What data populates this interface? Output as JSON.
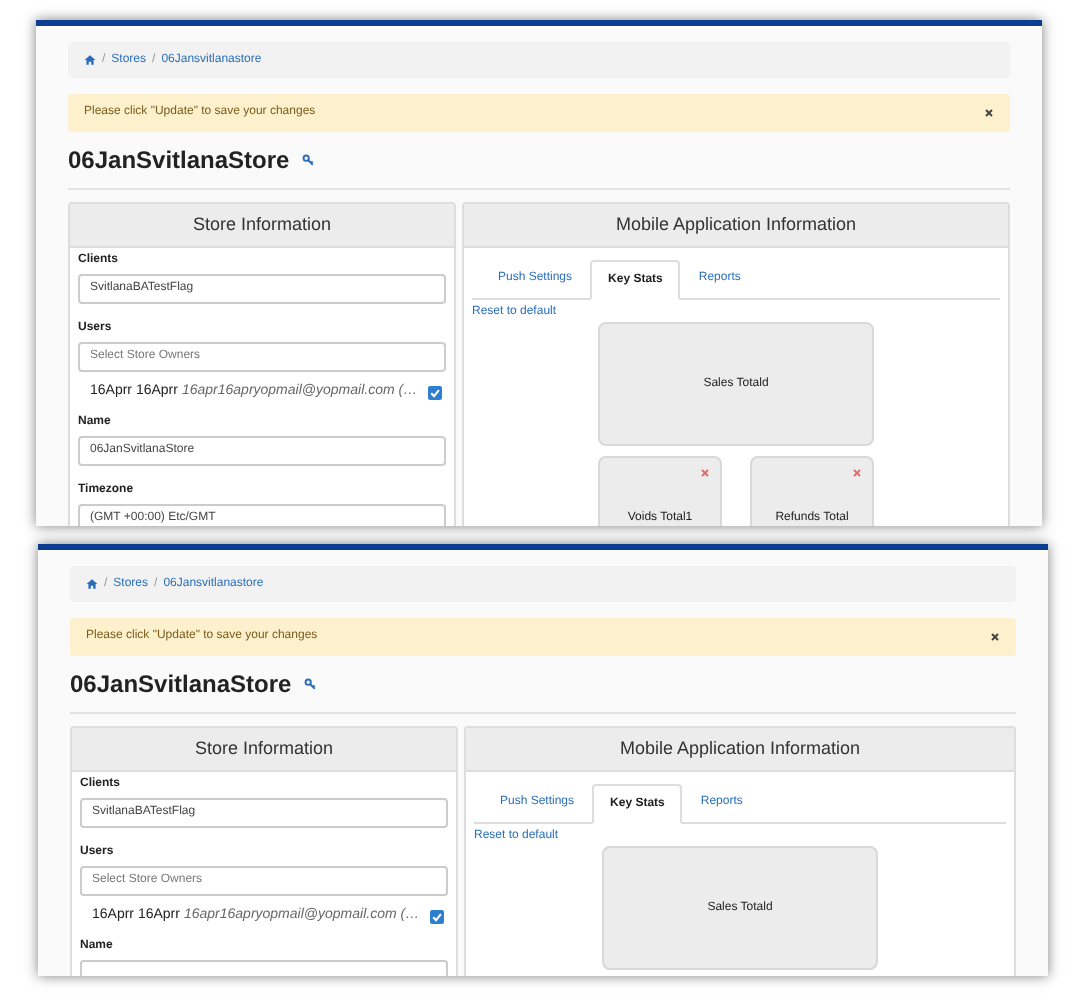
{
  "screens": [
    {
      "breadcrumb": {
        "separator": "/",
        "items": [
          "Stores",
          "06Jansvitlanastore"
        ]
      },
      "alert": {
        "message": "Please click \"Update\" to save your changes",
        "dismissible": true
      },
      "title": "06JanSvitlanaStore",
      "store_panel": {
        "title": "Store Information",
        "fields": [
          {
            "kind": "input",
            "label": "Clients",
            "value": "SvitlanaBATestFlag"
          },
          {
            "kind": "users",
            "label": "Users",
            "placeholder": "Select Store Owners",
            "users": [
              {
                "name": "16Aprr 16Aprr",
                "email": "16apr16apryopmail@yopmail.com (…",
                "checked": true
              }
            ]
          },
          {
            "kind": "input",
            "label": "Name",
            "value": "06JanSvitlanaStore"
          },
          {
            "kind": "input",
            "label": "Timezone",
            "value": "(GMT +00:00) Etc/GMT"
          }
        ]
      },
      "mobile_panel": {
        "title": "Mobile Application Information",
        "tabs": [
          {
            "label": "Push Settings",
            "selected": false
          },
          {
            "label": "Key Stats",
            "selected": true
          },
          {
            "label": "Reports",
            "selected": false
          }
        ],
        "reset_link": "Reset to default",
        "stats": [
          {
            "kind": "large",
            "label": "Sales Totald",
            "removable": false
          },
          {
            "kind": "small",
            "label": "Voids Total1",
            "removable": true
          },
          {
            "kind": "small",
            "label": "Refunds Total",
            "removable": true
          }
        ]
      }
    },
    {
      "breadcrumb": {
        "separator": "/",
        "items": [
          "Stores",
          "06Jansvitlanastore"
        ]
      },
      "alert": {
        "message": "Please click \"Update\" to save your changes",
        "dismissible": true
      },
      "title": "06JanSvitlanaStore",
      "store_panel": {
        "title": "Store Information",
        "fields": [
          {
            "kind": "input",
            "label": "Clients",
            "value": "SvitlanaBATestFlag"
          },
          {
            "kind": "users",
            "label": "Users",
            "placeholder": "Select Store Owners",
            "users": [
              {
                "name": "16Aprr 16Aprr",
                "email": "16apr16apryopmail@yopmail.com (…",
                "checked": true
              }
            ]
          },
          {
            "kind": "input",
            "label": "Name"
          }
        ]
      },
      "mobile_panel": {
        "title": "Mobile Application Information",
        "tabs": [
          {
            "label": "Push Settings",
            "selected": false
          },
          {
            "label": "Key Stats",
            "selected": true
          },
          {
            "label": "Reports",
            "selected": false
          }
        ],
        "reset_link": "Reset to default",
        "stats": [
          {
            "kind": "large",
            "label": "Sales Totald",
            "removable": false
          }
        ]
      }
    }
  ]
}
